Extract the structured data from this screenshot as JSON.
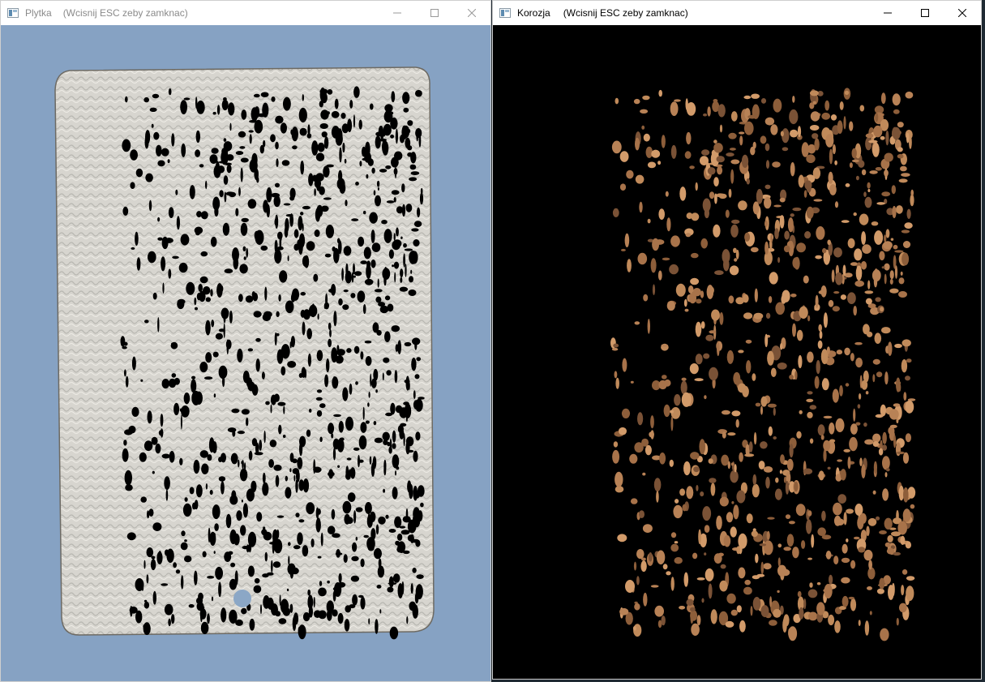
{
  "windows": [
    {
      "title": "Plytka",
      "subtitle": "(Wcisnij ESC zeby zamknac)",
      "state": "inactive"
    },
    {
      "title": "Korozja",
      "subtitle": "(Wcisnij ESC zeby zamknac)",
      "state": "active"
    }
  ],
  "controls": {
    "minimize_icon": "minimize-icon",
    "maximize_icon": "maximize-icon",
    "close_icon": "close-icon"
  },
  "colors": {
    "background_blue": "#8aa6c4",
    "plate": "#d8d6d0",
    "mask_black": "#000000",
    "rust": "#b07a4a"
  }
}
